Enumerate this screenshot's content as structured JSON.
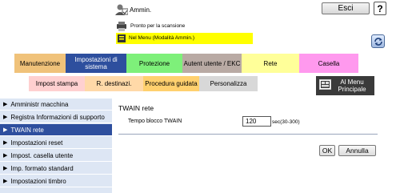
{
  "header": {
    "user_label": "Ammin.",
    "logout_label": "Esci",
    "help_label": "?",
    "status_text": "Pronto per la scansione",
    "menu_status": "Nel Menu (Modalità Ammin.)"
  },
  "tabs_row1": [
    {
      "label": "Manutenzione"
    },
    {
      "label": "Impostazioni di sistema"
    },
    {
      "label": "Protezione"
    },
    {
      "label": "Autent utente / EKC"
    },
    {
      "label": "Rete"
    },
    {
      "label": "Casella"
    }
  ],
  "tabs_row2": [
    {
      "label": "Impost stampa"
    },
    {
      "label": "R. destinazi."
    },
    {
      "label": "Procedura guidata"
    },
    {
      "label": "Personalizza"
    }
  ],
  "main_menu_label": "Al Menu Principale",
  "sidebar": {
    "items": [
      {
        "label": "Amministr macchina"
      },
      {
        "label": "Registra Informazioni di supporto"
      },
      {
        "label": "TWAIN rete"
      },
      {
        "label": "Impostazioni reset"
      },
      {
        "label": "Impost. casella utente"
      },
      {
        "label": "Imp. formato standard"
      },
      {
        "label": "Impostazioni timbro"
      }
    ]
  },
  "content": {
    "title": "TWAIN rete",
    "field_label": "Tempo blocco TWAIN",
    "field_value": "120",
    "field_unit": "sec(30-300)",
    "ok_label": "OK",
    "cancel_label": "Annulla"
  },
  "colors": {
    "active_tab": "#2e4f9e",
    "status_bar": "#ffff00",
    "sidebar_bg": "#dde6f4"
  },
  "icons": [
    "user-icon",
    "printer-icon",
    "menu-icon",
    "refresh-icon",
    "main-menu-icon",
    "arrow-icon"
  ]
}
